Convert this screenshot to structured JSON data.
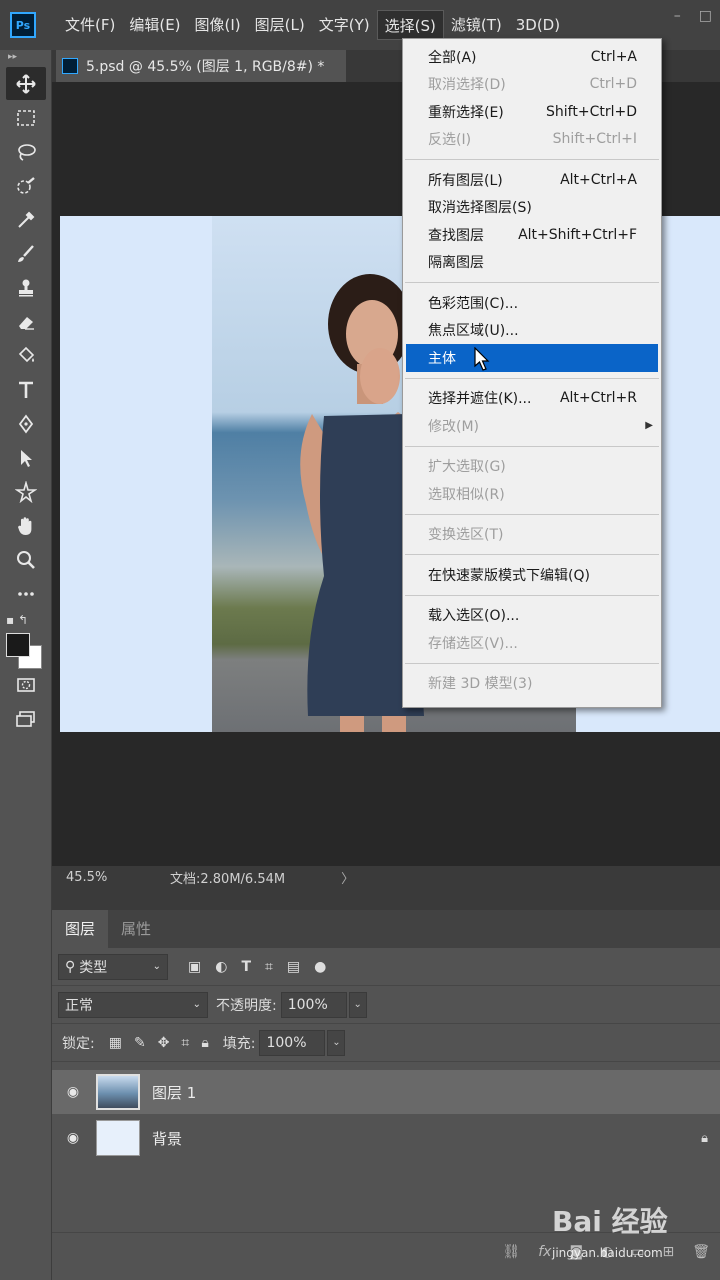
{
  "menubar": {
    "logo": "Ps",
    "items": [
      "文件(F)",
      "编辑(E)",
      "图像(I)",
      "图层(L)",
      "文字(Y)",
      "选择(S)",
      "滤镜(T)",
      "3D(D)"
    ],
    "active_index": 5,
    "window_controls": [
      "–",
      "□"
    ]
  },
  "document": {
    "tab_title": "5.psd @ 45.5% (图层 1, RGB/8#) *"
  },
  "status": {
    "zoom": "45.5%",
    "doc_size": "文档:2.80M/6.54M",
    "arrow": "〉"
  },
  "select_menu": {
    "groups": [
      [
        {
          "label": "全部(A)",
          "shortcut": "Ctrl+A",
          "enabled": true
        },
        {
          "label": "取消选择(D)",
          "shortcut": "Ctrl+D",
          "enabled": false
        },
        {
          "label": "重新选择(E)",
          "shortcut": "Shift+Ctrl+D",
          "enabled": true
        },
        {
          "label": "反选(I)",
          "shortcut": "Shift+Ctrl+I",
          "enabled": false
        }
      ],
      [
        {
          "label": "所有图层(L)",
          "shortcut": "Alt+Ctrl+A",
          "enabled": true
        },
        {
          "label": "取消选择图层(S)",
          "shortcut": "",
          "enabled": true
        },
        {
          "label": "查找图层",
          "shortcut": "Alt+Shift+Ctrl+F",
          "enabled": true
        },
        {
          "label": "隔离图层",
          "shortcut": "",
          "enabled": true
        }
      ],
      [
        {
          "label": "色彩范围(C)...",
          "shortcut": "",
          "enabled": true
        },
        {
          "label": "焦点区域(U)...",
          "shortcut": "",
          "enabled": true
        },
        {
          "label": "主体",
          "shortcut": "",
          "enabled": true,
          "highlighted": true
        }
      ],
      [
        {
          "label": "选择并遮住(K)...",
          "shortcut": "Alt+Ctrl+R",
          "enabled": true
        },
        {
          "label": "修改(M)",
          "shortcut": "",
          "enabled": false,
          "submenu": true
        }
      ],
      [
        {
          "label": "扩大选取(G)",
          "shortcut": "",
          "enabled": false
        },
        {
          "label": "选取相似(R)",
          "shortcut": "",
          "enabled": false
        }
      ],
      [
        {
          "label": "变换选区(T)",
          "shortcut": "",
          "enabled": false
        }
      ],
      [
        {
          "label": "在快速蒙版模式下编辑(Q)",
          "shortcut": "",
          "enabled": true
        }
      ],
      [
        {
          "label": "载入选区(O)...",
          "shortcut": "",
          "enabled": true
        },
        {
          "label": "存储选区(V)...",
          "shortcut": "",
          "enabled": false
        }
      ],
      [
        {
          "label": "新建 3D 模型(3)",
          "shortcut": "",
          "enabled": false
        }
      ]
    ]
  },
  "layers_panel": {
    "tabs": [
      "图层",
      "属性"
    ],
    "filter_label": "类型",
    "blend_mode": "正常",
    "opacity_label": "不透明度:",
    "opacity_value": "100%",
    "lock_label": "锁定:",
    "fill_label": "填充:",
    "fill_value": "100%",
    "layers": [
      {
        "name": "图层 1",
        "visible": true,
        "selected": true,
        "locked": false
      },
      {
        "name": "背景",
        "visible": true,
        "selected": false,
        "locked": true
      }
    ],
    "footer_fx": "fx"
  },
  "watermark": {
    "brand": "Bai 经验",
    "url": "jingyan.baidu.com"
  },
  "colors": {
    "highlight": "#0a64c8",
    "menubar_bg": "#424242",
    "canvas_bg": "#282828"
  }
}
